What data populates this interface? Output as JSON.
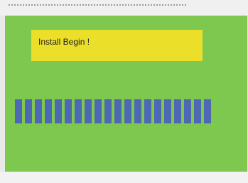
{
  "message": {
    "text": "Install Begin !"
  },
  "progress": {
    "filled_segments": 20,
    "fraction": 1.0
  },
  "colors": {
    "screen_background": "#7ec850",
    "message_background": "#ecdf2a",
    "progress_segment": "#4d68b4"
  }
}
